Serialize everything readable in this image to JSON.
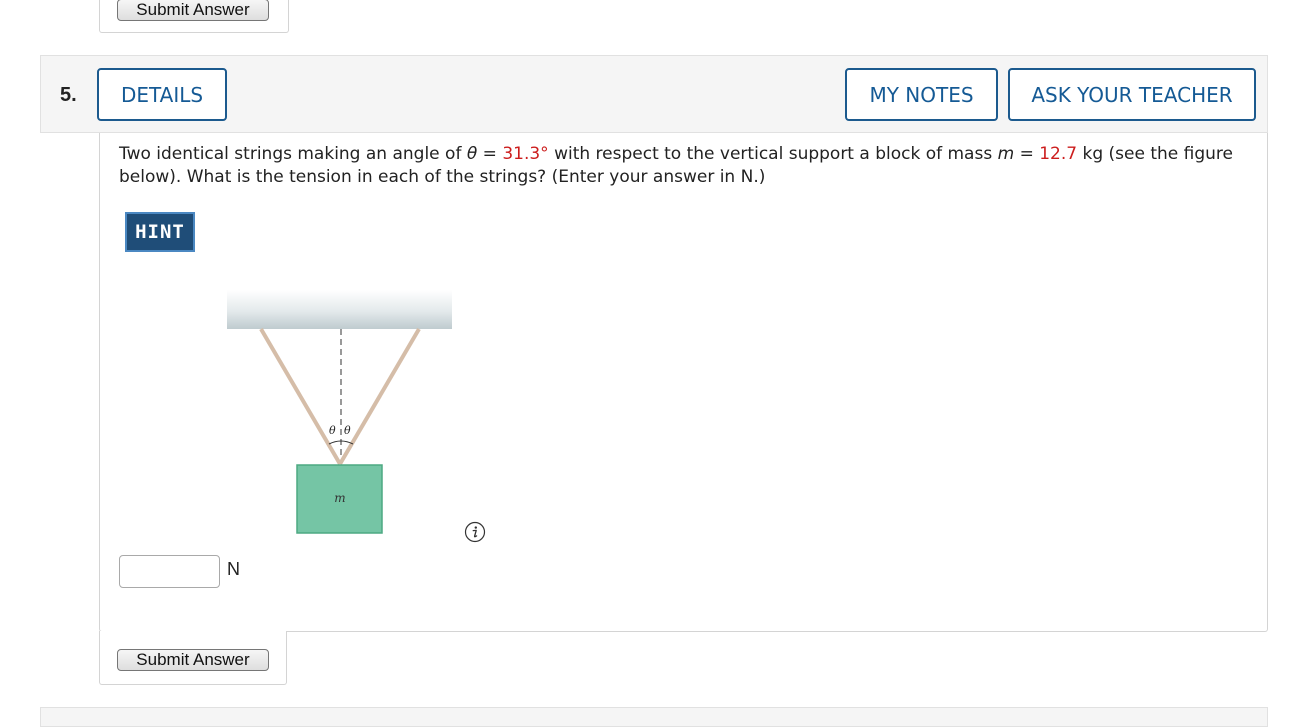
{
  "previous_question": {
    "submit_label": "Submit Answer"
  },
  "question": {
    "number": "5.",
    "details_label": "DETAILS",
    "my_notes_label": "MY NOTES",
    "ask_teacher_label": "ASK YOUR TEACHER",
    "text": {
      "part1": "Two identical strings making an angle of ",
      "theta_symbol": "θ",
      "eq1": " = ",
      "theta_value": "31.3°",
      "part2": " with respect to the vertical support a block of mass ",
      "m_symbol": "m",
      "eq2": " = ",
      "mass_value": "12.7",
      "part3": " kg (see the figure below). What is the tension in each of the strings? (Enter your answer in N.)"
    },
    "hint_label": "HINT",
    "figure": {
      "theta_left": "θ",
      "theta_right": "θ",
      "block_label": "m"
    },
    "answer": {
      "value": "",
      "unit": "N"
    },
    "submit_label": "Submit Answer"
  },
  "colors": {
    "accent": "#1c5a8e",
    "given_value": "#cc1d1d",
    "hint_bg": "#1f4d78",
    "block": "#75c5a5"
  },
  "icons": {
    "info": "info-circle-icon"
  }
}
